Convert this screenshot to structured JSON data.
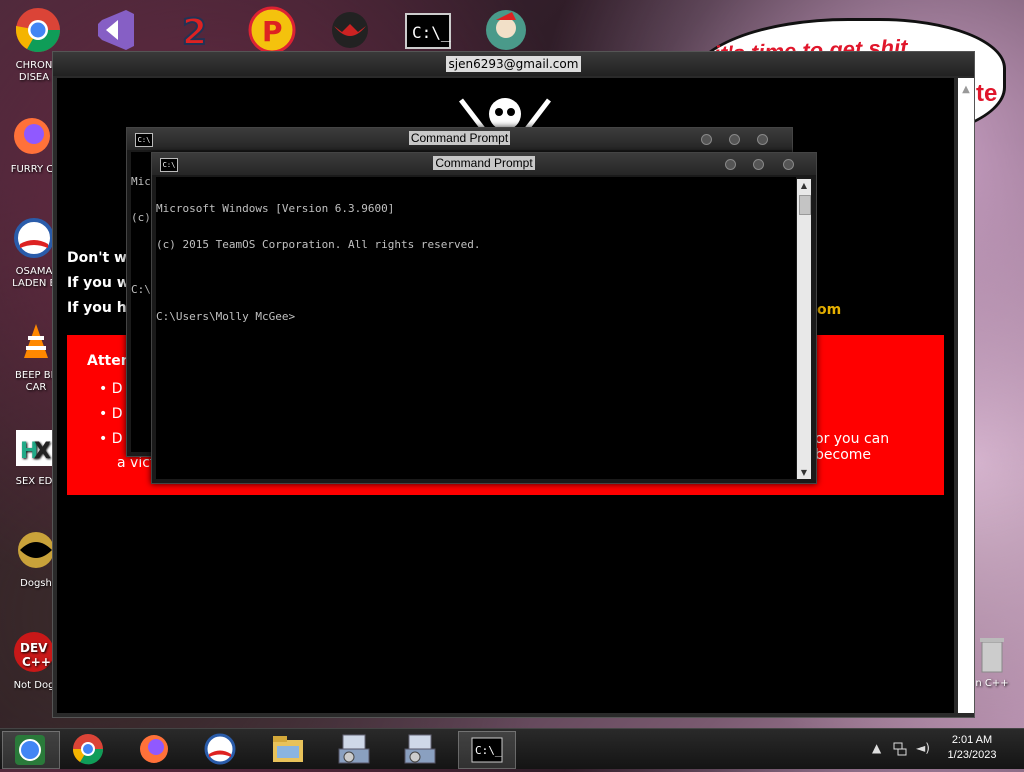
{
  "desktop": {
    "icons": [
      {
        "label": "CHRON\nDISEA",
        "name": "chrome"
      },
      {
        "label": "FURRY C",
        "name": "firefox"
      },
      {
        "label": "OSAMA\nLADEN E",
        "name": "obama-campaign"
      },
      {
        "label": "BEEP BE\nCAR",
        "name": "vlc"
      },
      {
        "label": "SEX ED",
        "name": "hx"
      },
      {
        "label": "Dogsh",
        "name": "dogshow"
      },
      {
        "label": "Not Dog",
        "name": "devcpp"
      }
    ],
    "right_icons": [
      {
        "label": "n C++",
        "name": "recycle-bin"
      }
    ],
    "wallpaper_text_1": "it's time to get shit",
    "wallpaper_text_2": "te"
  },
  "main_window": {
    "title": "sjen6293@gmail.com",
    "lines": [
      "Don't wo",
      "If you w",
      "If you ha"
    ],
    "email_fragment": "om",
    "attention_title": "Atten",
    "bullets": [
      "D",
      "D",
      "D"
    ],
    "bullet_tail": "or you can become",
    "bullet_tail2": "a vict"
  },
  "cmd_back": {
    "title": "Command Prompt",
    "lines": [
      "Mic",
      "(c)",
      "",
      "C:\\"
    ]
  },
  "cmd_front": {
    "title": "Command Prompt",
    "lines": [
      "Microsoft Windows [Version 6.3.9600]",
      "(c) 2015 TeamOS Corporation. All rights reserved.",
      "",
      "C:\\Users\\Molly McGee>"
    ]
  },
  "taskbar": {
    "time": "2:01 AM",
    "date": "1/23/2023",
    "buttons": [
      "start",
      "chrome",
      "firefox",
      "obama",
      "file-explorer",
      "installer-1",
      "installer-2",
      "command-prompt"
    ]
  }
}
